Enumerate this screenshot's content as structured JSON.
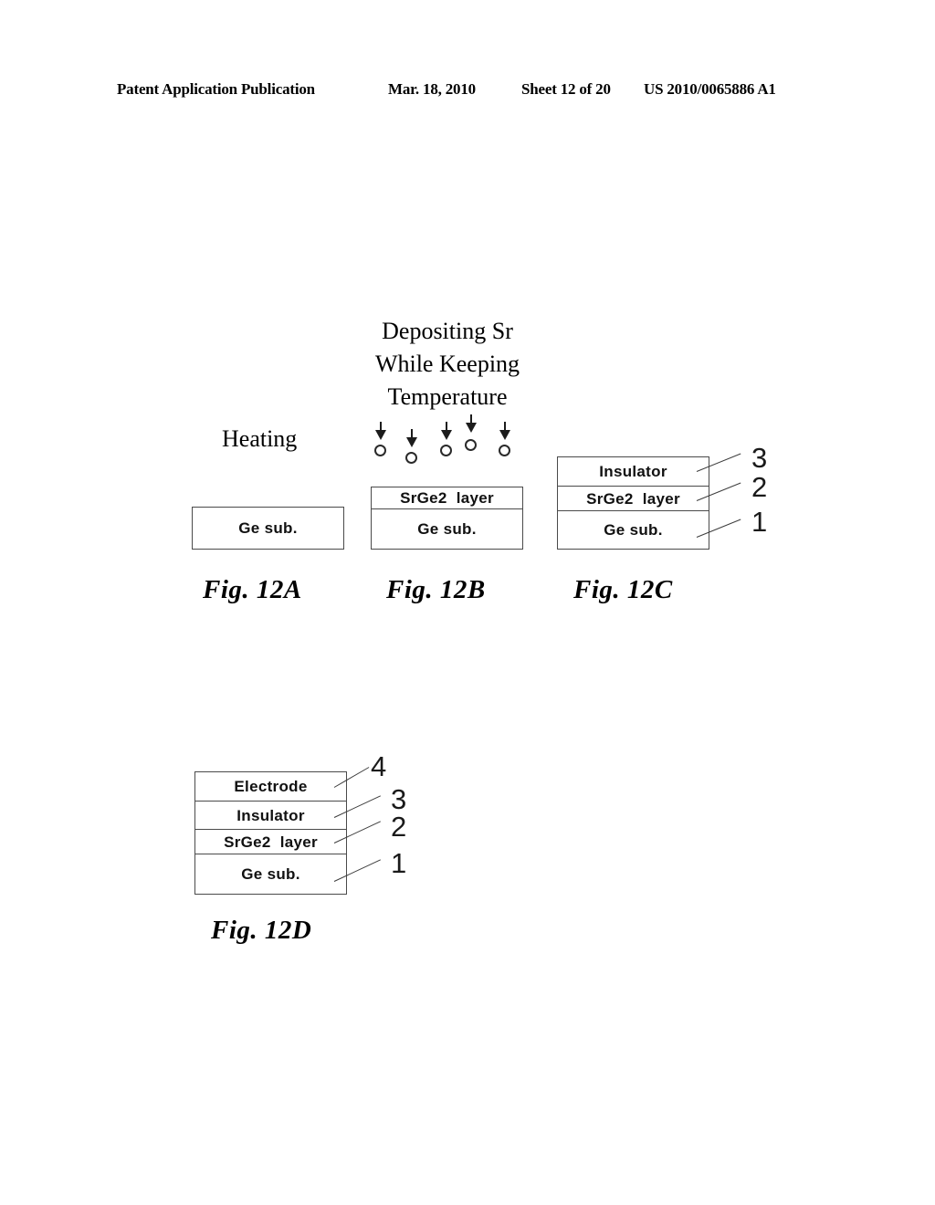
{
  "header": {
    "publication": "Patent Application Publication",
    "date": "Mar. 18, 2010",
    "sheet": "Sheet 12 of 20",
    "patent_number": "US 2010/0065886 A1"
  },
  "annotations": {
    "heating": "Heating",
    "depositing_line1": "Depositing Sr",
    "depositing_line2": "While Keeping",
    "depositing_line3": "Temperature"
  },
  "figures": [
    {
      "id": "fig-12a",
      "caption": "Fig. 12A",
      "layers": [
        {
          "label": "Ge sub.",
          "ref": null
        }
      ]
    },
    {
      "id": "fig-12b",
      "caption": "Fig. 12B",
      "layers": [
        {
          "label": "SrGe2  layer",
          "ref": null
        },
        {
          "label": "Ge sub.",
          "ref": null
        }
      ]
    },
    {
      "id": "fig-12c",
      "caption": "Fig. 12C",
      "layers": [
        {
          "label": "Insulator",
          "ref": "3"
        },
        {
          "label": "SrGe2  layer",
          "ref": "2"
        },
        {
          "label": "Ge sub.",
          "ref": "1"
        }
      ]
    },
    {
      "id": "fig-12d",
      "caption": "Fig. 12D",
      "layers": [
        {
          "label": "Electrode",
          "ref": "4"
        },
        {
          "label": "Insulator",
          "ref": "3"
        },
        {
          "label": "SrGe2  layer",
          "ref": "2"
        },
        {
          "label": "Ge sub.",
          "ref": "1"
        }
      ]
    }
  ],
  "deposition_arrows": {
    "count": 5,
    "symbol": "down-arrow-with-atom"
  },
  "colors": {
    "ink": "#000000",
    "line": "#4a4a4a",
    "page": "#ffffff"
  }
}
